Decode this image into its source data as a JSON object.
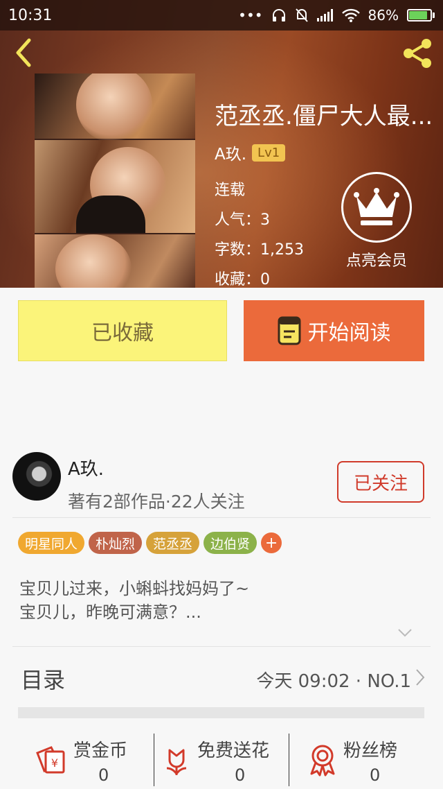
{
  "status_bar": {
    "time": "10:31",
    "dots": "•••",
    "battery": "86%"
  },
  "book": {
    "title": "范丞丞.僵尸大人最...",
    "author": "A玖.",
    "level": "Lv1",
    "status": "连载",
    "popularity": "人气：3",
    "words": "字数：1,253",
    "favorites": "收藏：0"
  },
  "vip": {
    "label": "点亮会员"
  },
  "actions": {
    "collected_label": "已收藏",
    "read_label": "开始阅读"
  },
  "author_card": {
    "name": "A玖.",
    "stats": "著有2部作品·22人关注",
    "follow_label": "已关注"
  },
  "tags": [
    {
      "label": "明星同人",
      "color": "#f0a830"
    },
    {
      "label": "朴灿烈",
      "color": "#c0644a"
    },
    {
      "label": "范丞丞",
      "color": "#d6a23a"
    },
    {
      "label": "边伯贤",
      "color": "#8cb24a"
    }
  ],
  "tag_add": "+",
  "description": {
    "line1": "宝贝儿过来，小蝌蚪找妈妈了~",
    "line2": "宝贝儿，昨晚可满意？..."
  },
  "toc": {
    "title": "目录",
    "latest": "今天 09:02 · NO.1"
  },
  "bottom_bar": [
    {
      "label": "赏金币",
      "value": "0",
      "icon": "red-envelope-icon"
    },
    {
      "label": "免费送花",
      "value": "0",
      "icon": "flower-icon"
    },
    {
      "label": "粉丝榜",
      "value": "0",
      "icon": "medal-icon"
    }
  ],
  "colors": {
    "accent": "#eb6a3b",
    "collect_bg": "#fbf47a",
    "follow_red": "#d03a2a"
  }
}
